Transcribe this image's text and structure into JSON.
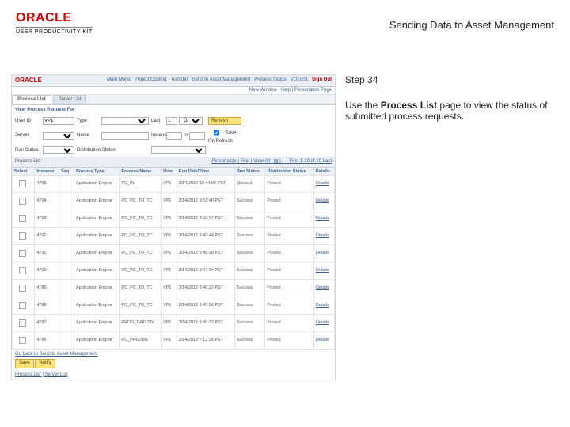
{
  "header": {
    "logo": "ORACLE",
    "upk": "USER PRODUCTIVITY KIT",
    "title": "Sending Data to Asset Management"
  },
  "right": {
    "step": "Step 34",
    "instr_a": "Use the ",
    "instr_b": "Process List",
    "instr_c": " page to view the status of submitted process requests."
  },
  "shot": {
    "logo": "ORACLE",
    "nav": [
      "Main Menu",
      "Project Costing",
      "Transfer",
      "Send to Asset Management",
      "Process Status",
      "VOT801",
      "Sign Out"
    ],
    "sub": "New Window | Help | Personalize Page",
    "tabs": [
      "Process List",
      "Server List"
    ],
    "section": "View Process Request For",
    "filters": {
      "user_label": "User ID",
      "user_value": "VP1",
      "type_label": "Type",
      "type_value": "",
      "last_label": "Last",
      "last_value": "",
      "days_value": "1",
      "days_unit": "Days",
      "refresh": "Refresh",
      "server_label": "Server",
      "name_label": "Name",
      "instance_label": "Instance",
      "to_label": "to",
      "save_chk": "Save On Refresh",
      "run_label": "Run Status",
      "dist_label": "Distribution Status"
    },
    "list_title": "Process List",
    "list_meta": "Personalize | Find | View All | ▤ | 📄  First 1-10 of 10 Last",
    "cols": [
      "Select",
      "Instance",
      "Seq.",
      "Process Type",
      "Process Name",
      "User",
      "Run Date/Time",
      "Run Status",
      "Distribution Status",
      "Details"
    ],
    "rows": [
      {
        "sel": false,
        "inst": "4795",
        "seq": "",
        "ptype": "Application Engine",
        "pname": "PC_IN",
        "user": "VP1",
        "dt": "3/14/2012 10:44:06 PST",
        "rstat": "Queued",
        "dstat": "Posted",
        "det": "Details"
      },
      {
        "sel": false,
        "inst": "4794",
        "seq": "",
        "ptype": "Application Engine",
        "pname": "PC_PC_TO_TC",
        "user": "VP1",
        "dt": "3/14/2012 9:51:40 PST",
        "rstat": "Success",
        "dstat": "Posted",
        "det": "Details"
      },
      {
        "sel": false,
        "inst": "4793",
        "seq": "",
        "ptype": "Application Engine",
        "pname": "PC_PC_TO_TC",
        "user": "VP1",
        "dt": "3/14/2012 9:50:57 PST",
        "rstat": "Success",
        "dstat": "Posted",
        "det": "Details"
      },
      {
        "sel": false,
        "inst": "4792",
        "seq": "",
        "ptype": "Application Engine",
        "pname": "PC_PC_TO_TC",
        "user": "VP1",
        "dt": "3/14/2012 9:49:44 PST",
        "rstat": "Success",
        "dstat": "Posted",
        "det": "Details"
      },
      {
        "sel": false,
        "inst": "4791",
        "seq": "",
        "ptype": "Application Engine",
        "pname": "PC_PC_TO_TC",
        "user": "VP1",
        "dt": "3/14/2012 9:48:28 PST",
        "rstat": "Success",
        "dstat": "Posted",
        "det": "Details"
      },
      {
        "sel": false,
        "inst": "4790",
        "seq": "",
        "ptype": "Application Engine",
        "pname": "PC_PC_TO_TC",
        "user": "VP1",
        "dt": "3/14/2012 9:47:34 PST",
        "rstat": "Success",
        "dstat": "Posted",
        "det": "Details"
      },
      {
        "sel": false,
        "inst": "4789",
        "seq": "",
        "ptype": "Application Engine",
        "pname": "PC_PC_TO_TC",
        "user": "VP1",
        "dt": "3/14/2012 9:46:22 PST",
        "rstat": "Success",
        "dstat": "Posted",
        "det": "Details"
      },
      {
        "sel": false,
        "inst": "4788",
        "seq": "",
        "ptype": "Application Engine",
        "pname": "PC_PC_TO_TC",
        "user": "VP1",
        "dt": "3/14/2012 9:43:56 PST",
        "rstat": "Success",
        "dstat": "Posted",
        "det": "Details"
      },
      {
        "sel": false,
        "inst": "4787",
        "seq": "",
        "ptype": "Application Engine",
        "pname": "PROG_DATCNV",
        "user": "VP1",
        "dt": "3/14/2012 9:30:22 PST",
        "rstat": "Success",
        "dstat": "Posted",
        "det": "Details"
      },
      {
        "sel": false,
        "inst": "4786",
        "seq": "",
        "ptype": "Application Engine",
        "pname": "PC_PRICING",
        "user": "VP1",
        "dt": "3/14/2012 7:12:36 PST",
        "rstat": "Success",
        "dstat": "Posted",
        "det": "Details"
      }
    ],
    "goback": "Go back to Send to Asset Management",
    "save": "Save",
    "notify": "Notify",
    "bottom_tabs": "Process List | Server List"
  }
}
